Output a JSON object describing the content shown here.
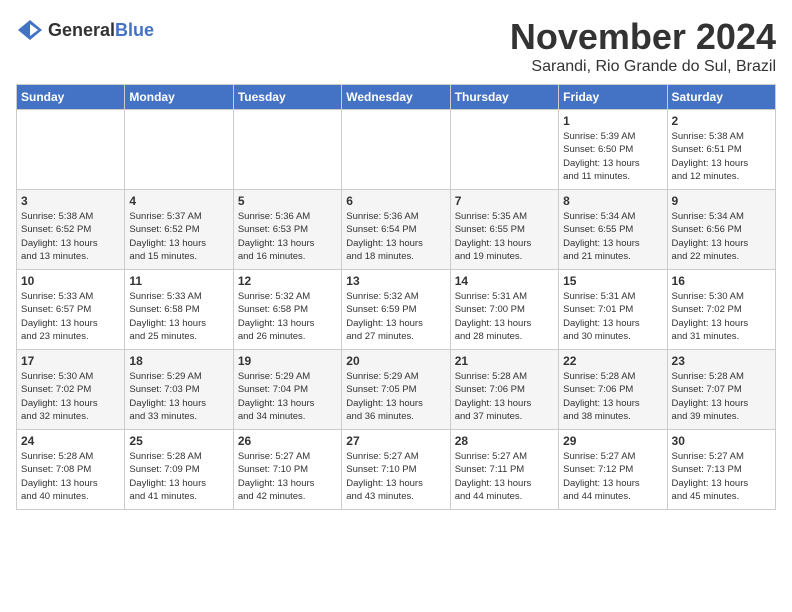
{
  "logo": {
    "text_general": "General",
    "text_blue": "Blue"
  },
  "header": {
    "month_title": "November 2024",
    "location": "Sarandi, Rio Grande do Sul, Brazil"
  },
  "weekdays": [
    "Sunday",
    "Monday",
    "Tuesday",
    "Wednesday",
    "Thursday",
    "Friday",
    "Saturday"
  ],
  "weeks": [
    [
      {
        "day": "",
        "info": ""
      },
      {
        "day": "",
        "info": ""
      },
      {
        "day": "",
        "info": ""
      },
      {
        "day": "",
        "info": ""
      },
      {
        "day": "",
        "info": ""
      },
      {
        "day": "1",
        "info": "Sunrise: 5:39 AM\nSunset: 6:50 PM\nDaylight: 13 hours\nand 11 minutes."
      },
      {
        "day": "2",
        "info": "Sunrise: 5:38 AM\nSunset: 6:51 PM\nDaylight: 13 hours\nand 12 minutes."
      }
    ],
    [
      {
        "day": "3",
        "info": "Sunrise: 5:38 AM\nSunset: 6:52 PM\nDaylight: 13 hours\nand 13 minutes."
      },
      {
        "day": "4",
        "info": "Sunrise: 5:37 AM\nSunset: 6:52 PM\nDaylight: 13 hours\nand 15 minutes."
      },
      {
        "day": "5",
        "info": "Sunrise: 5:36 AM\nSunset: 6:53 PM\nDaylight: 13 hours\nand 16 minutes."
      },
      {
        "day": "6",
        "info": "Sunrise: 5:36 AM\nSunset: 6:54 PM\nDaylight: 13 hours\nand 18 minutes."
      },
      {
        "day": "7",
        "info": "Sunrise: 5:35 AM\nSunset: 6:55 PM\nDaylight: 13 hours\nand 19 minutes."
      },
      {
        "day": "8",
        "info": "Sunrise: 5:34 AM\nSunset: 6:55 PM\nDaylight: 13 hours\nand 21 minutes."
      },
      {
        "day": "9",
        "info": "Sunrise: 5:34 AM\nSunset: 6:56 PM\nDaylight: 13 hours\nand 22 minutes."
      }
    ],
    [
      {
        "day": "10",
        "info": "Sunrise: 5:33 AM\nSunset: 6:57 PM\nDaylight: 13 hours\nand 23 minutes."
      },
      {
        "day": "11",
        "info": "Sunrise: 5:33 AM\nSunset: 6:58 PM\nDaylight: 13 hours\nand 25 minutes."
      },
      {
        "day": "12",
        "info": "Sunrise: 5:32 AM\nSunset: 6:58 PM\nDaylight: 13 hours\nand 26 minutes."
      },
      {
        "day": "13",
        "info": "Sunrise: 5:32 AM\nSunset: 6:59 PM\nDaylight: 13 hours\nand 27 minutes."
      },
      {
        "day": "14",
        "info": "Sunrise: 5:31 AM\nSunset: 7:00 PM\nDaylight: 13 hours\nand 28 minutes."
      },
      {
        "day": "15",
        "info": "Sunrise: 5:31 AM\nSunset: 7:01 PM\nDaylight: 13 hours\nand 30 minutes."
      },
      {
        "day": "16",
        "info": "Sunrise: 5:30 AM\nSunset: 7:02 PM\nDaylight: 13 hours\nand 31 minutes."
      }
    ],
    [
      {
        "day": "17",
        "info": "Sunrise: 5:30 AM\nSunset: 7:02 PM\nDaylight: 13 hours\nand 32 minutes."
      },
      {
        "day": "18",
        "info": "Sunrise: 5:29 AM\nSunset: 7:03 PM\nDaylight: 13 hours\nand 33 minutes."
      },
      {
        "day": "19",
        "info": "Sunrise: 5:29 AM\nSunset: 7:04 PM\nDaylight: 13 hours\nand 34 minutes."
      },
      {
        "day": "20",
        "info": "Sunrise: 5:29 AM\nSunset: 7:05 PM\nDaylight: 13 hours\nand 36 minutes."
      },
      {
        "day": "21",
        "info": "Sunrise: 5:28 AM\nSunset: 7:06 PM\nDaylight: 13 hours\nand 37 minutes."
      },
      {
        "day": "22",
        "info": "Sunrise: 5:28 AM\nSunset: 7:06 PM\nDaylight: 13 hours\nand 38 minutes."
      },
      {
        "day": "23",
        "info": "Sunrise: 5:28 AM\nSunset: 7:07 PM\nDaylight: 13 hours\nand 39 minutes."
      }
    ],
    [
      {
        "day": "24",
        "info": "Sunrise: 5:28 AM\nSunset: 7:08 PM\nDaylight: 13 hours\nand 40 minutes."
      },
      {
        "day": "25",
        "info": "Sunrise: 5:28 AM\nSunset: 7:09 PM\nDaylight: 13 hours\nand 41 minutes."
      },
      {
        "day": "26",
        "info": "Sunrise: 5:27 AM\nSunset: 7:10 PM\nDaylight: 13 hours\nand 42 minutes."
      },
      {
        "day": "27",
        "info": "Sunrise: 5:27 AM\nSunset: 7:10 PM\nDaylight: 13 hours\nand 43 minutes."
      },
      {
        "day": "28",
        "info": "Sunrise: 5:27 AM\nSunset: 7:11 PM\nDaylight: 13 hours\nand 44 minutes."
      },
      {
        "day": "29",
        "info": "Sunrise: 5:27 AM\nSunset: 7:12 PM\nDaylight: 13 hours\nand 44 minutes."
      },
      {
        "day": "30",
        "info": "Sunrise: 5:27 AM\nSunset: 7:13 PM\nDaylight: 13 hours\nand 45 minutes."
      }
    ]
  ]
}
